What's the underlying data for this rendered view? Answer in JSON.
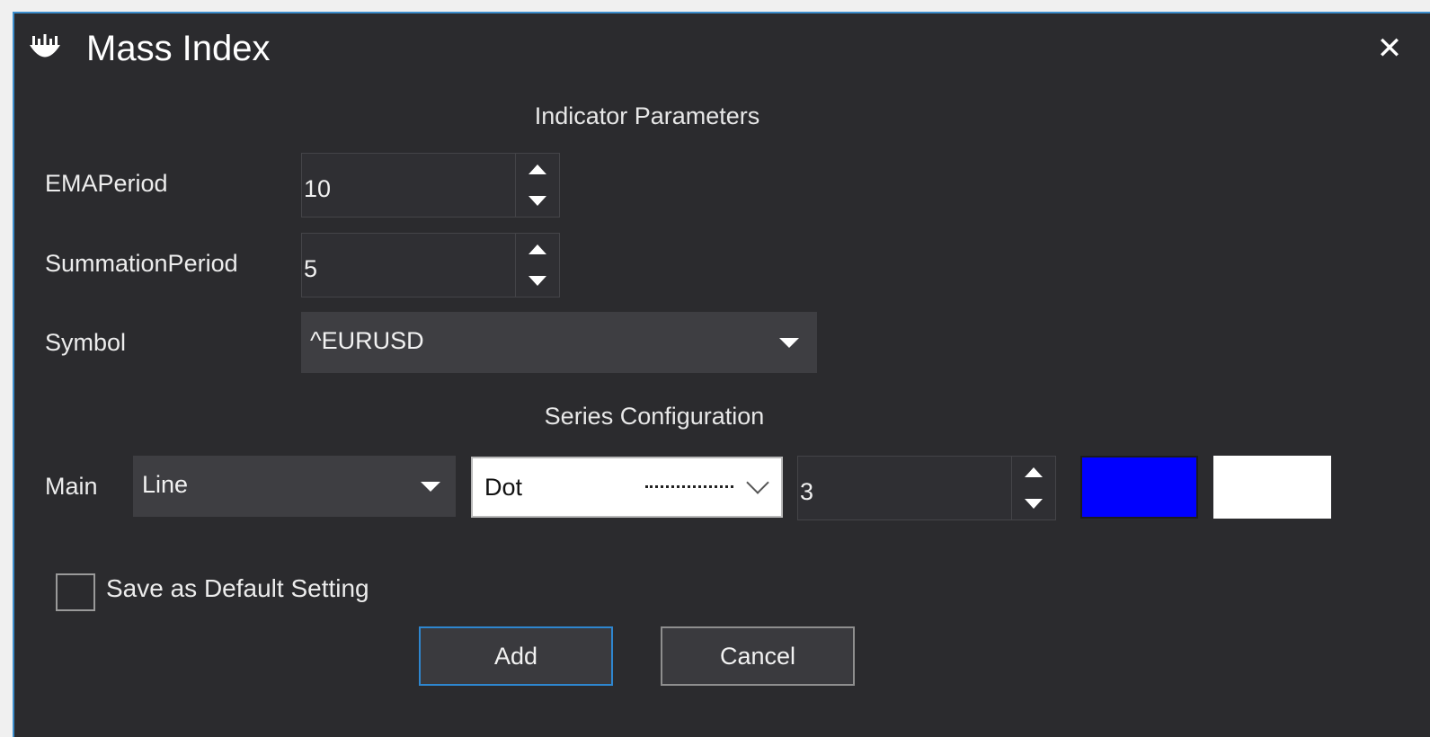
{
  "window": {
    "title": "Mass Index",
    "close_glyph": "✕"
  },
  "sections": {
    "indicator_parameters": "Indicator Parameters",
    "series_configuration": "Series Configuration"
  },
  "parameters": {
    "ema_period": {
      "label": "EMAPeriod",
      "value": "10"
    },
    "summation_period": {
      "label": "SummationPeriod",
      "value": "5"
    },
    "symbol": {
      "label": "Symbol",
      "value": "^EURUSD"
    }
  },
  "series": {
    "main": {
      "label": "Main",
      "chart_type": "Line",
      "line_style": "Dot",
      "width": "3",
      "line_color": "#0000ff",
      "secondary_color": "#ffffff"
    }
  },
  "save_default": {
    "label": "Save as Default Setting",
    "checked": false
  },
  "buttons": {
    "add": "Add",
    "cancel": "Cancel"
  },
  "icons": {
    "app": "indicator-logo-icon",
    "close": "close-icon",
    "spin_up": "spin-up-icon",
    "spin_down": "spin-down-icon",
    "dropdown": "chevron-down-icon"
  },
  "colors": {
    "background": "#2b2b2e",
    "accent": "#2e86cf"
  }
}
